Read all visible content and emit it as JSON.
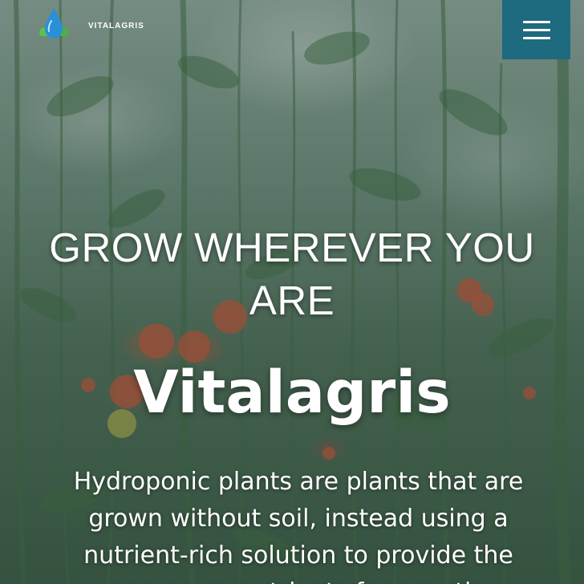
{
  "header": {
    "logo_text": "VITALAGRIS",
    "menu_icon": "hamburger-menu-icon"
  },
  "hero": {
    "headline": "GROW WHEREVER YOU ARE",
    "brand": "Vitalagris",
    "description": "Hydroponic plants are plants that are grown without soil, instead using a nutrient-rich solution to provide the necessary nutrients for growth."
  },
  "colors": {
    "menu_button": "#1e6a7f",
    "text": "#ffffff",
    "logo_drop": "#2a8fd6",
    "logo_leaf": "#5cc24a"
  }
}
